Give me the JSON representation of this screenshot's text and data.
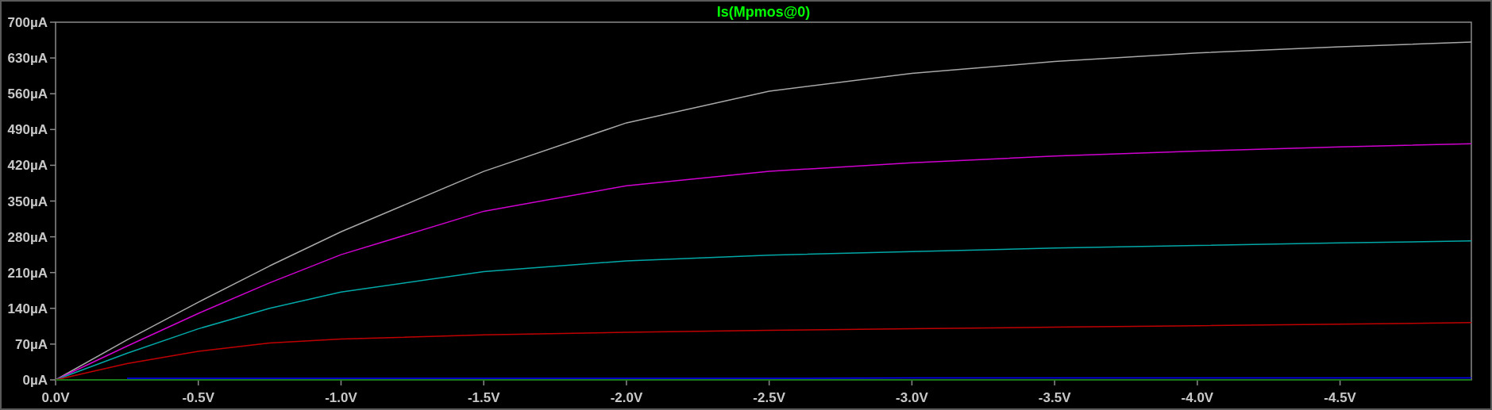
{
  "plot": {
    "chart_data": {
      "type": "line",
      "title": "Is(Mpmos@0)",
      "x": [
        0,
        -0.25,
        -0.5,
        -0.75,
        -1.0,
        -1.5,
        -2.0,
        -2.5,
        -3.0,
        -3.5,
        -4.0,
        -4.5,
        -4.96
      ],
      "xlim": [
        0,
        -4.96
      ],
      "ylim": [
        0,
        700
      ],
      "xticks": [
        {
          "value": 0,
          "label": "0.0V"
        },
        {
          "value": -0.5,
          "label": "-0.5V"
        },
        {
          "value": -1.0,
          "label": "-1.0V"
        },
        {
          "value": -1.5,
          "label": "-1.5V"
        },
        {
          "value": -2.0,
          "label": "-2.0V"
        },
        {
          "value": -2.5,
          "label": "-2.5V"
        },
        {
          "value": -3.0,
          "label": "-3.0V"
        },
        {
          "value": -3.5,
          "label": "-3.5V"
        },
        {
          "value": -4.0,
          "label": "-4.0V"
        },
        {
          "value": -4.5,
          "label": "-4.5V"
        }
      ],
      "yticks": [
        {
          "value": 0,
          "label": "0µA"
        },
        {
          "value": 70,
          "label": "70µA"
        },
        {
          "value": 140,
          "label": "140µA"
        },
        {
          "value": 210,
          "label": "210µA"
        },
        {
          "value": 280,
          "label": "280µA"
        },
        {
          "value": 350,
          "label": "350µA"
        },
        {
          "value": 420,
          "label": "420µA"
        },
        {
          "value": 490,
          "label": "490µA"
        },
        {
          "value": 560,
          "label": "560µA"
        },
        {
          "value": 630,
          "label": "630µA"
        },
        {
          "value": 700,
          "label": "700µA"
        }
      ],
      "series": [
        {
          "color": "#a8a8a8",
          "values": [
            0,
            78,
            152,
            223,
            290,
            408,
            503,
            565,
            600,
            623,
            640,
            652,
            661
          ]
        },
        {
          "color": "#d000d0",
          "values": [
            0,
            66,
            130,
            190,
            245,
            330,
            380,
            408,
            425,
            438,
            448,
            456,
            462
          ]
        },
        {
          "color": "#00a8a8",
          "values": [
            0,
            52,
            100,
            140,
            172,
            212,
            233,
            244,
            251,
            258,
            263,
            268,
            272
          ]
        },
        {
          "color": "#c00000",
          "values": [
            0,
            32,
            56,
            72,
            80,
            88,
            93,
            97,
            100,
            103,
            106,
            109,
            112
          ]
        },
        {
          "color": "#008000",
          "values": [
            0,
            0,
            0,
            0,
            0,
            0,
            0,
            0,
            0,
            0,
            0,
            0,
            0
          ]
        },
        {
          "color": "#0000ff",
          "values": [
            null,
            3,
            3,
            3,
            3,
            3,
            3,
            3,
            4,
            4,
            4,
            4,
            4
          ]
        }
      ]
    }
  }
}
